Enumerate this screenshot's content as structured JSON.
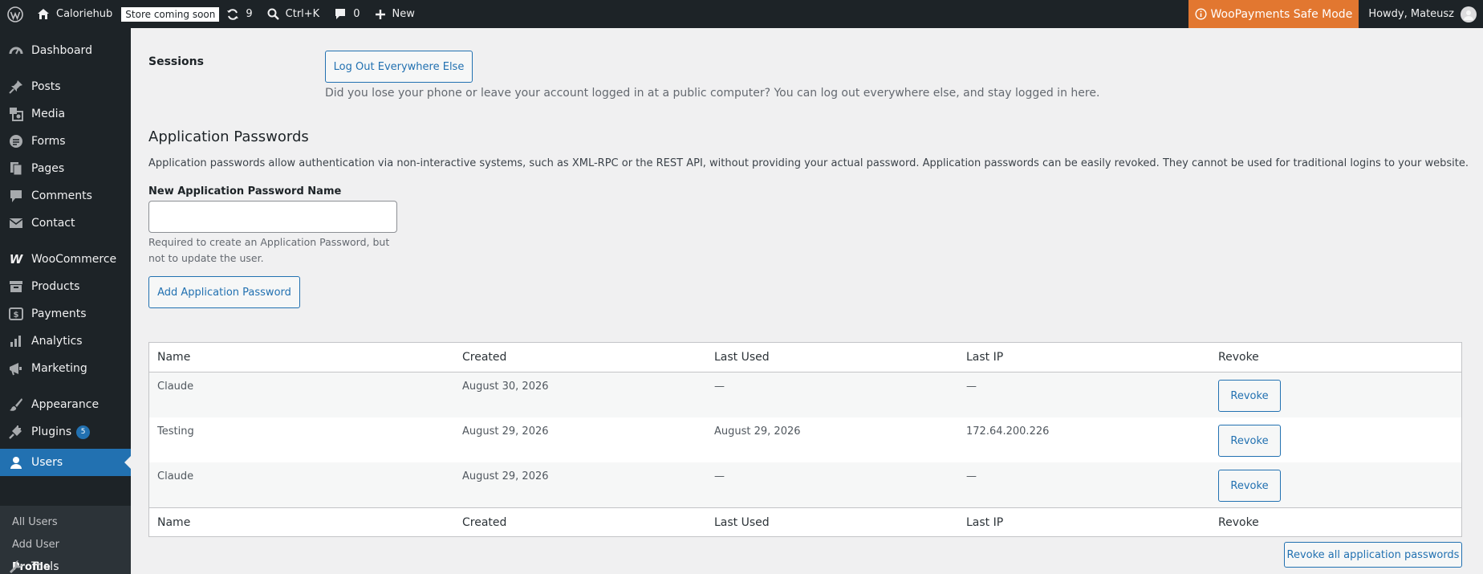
{
  "adminbar": {
    "site_name": "Caloriehub",
    "store_badge": "Store coming soon",
    "updates_count": "9",
    "search_shortcut": "Ctrl+K",
    "comments_count": "0",
    "new_label": "New",
    "woopayments_notice": "WooPayments Safe Mode",
    "howdy": "Howdy, Mateusz",
    "safe_mode_color": "#e27730"
  },
  "sidebar": {
    "items": [
      {
        "label": "Dashboard",
        "icon": "dashboard-icon"
      },
      {
        "label": "Posts",
        "icon": "pin-icon"
      },
      {
        "label": "Media",
        "icon": "media-icon"
      },
      {
        "label": "Forms",
        "icon": "forms-icon"
      },
      {
        "label": "Pages",
        "icon": "pages-icon"
      },
      {
        "label": "Comments",
        "icon": "comments-icon"
      },
      {
        "label": "Contact",
        "icon": "mail-icon"
      },
      {
        "label": "WooCommerce",
        "icon": "woocommerce-icon"
      },
      {
        "label": "Products",
        "icon": "archive-icon"
      },
      {
        "label": "Payments",
        "icon": "payments-icon"
      },
      {
        "label": "Analytics",
        "icon": "analytics-icon"
      },
      {
        "label": "Marketing",
        "icon": "megaphone-icon"
      },
      {
        "label": "Appearance",
        "icon": "brush-icon"
      },
      {
        "label": "Plugins",
        "icon": "plugin-icon",
        "badge": "5"
      },
      {
        "label": "Users",
        "icon": "users-icon"
      },
      {
        "label": "Tools",
        "icon": "wrench-icon"
      }
    ],
    "submenu": [
      "All Users",
      "Add User",
      "Profile"
    ],
    "accent_color": "#2271b1"
  },
  "sessions": {
    "label": "Sessions",
    "button": "Log Out Everywhere Else",
    "description": "Did you lose your phone or leave your account logged in at a public computer? You can log out everywhere else, and stay logged in here."
  },
  "app_passwords": {
    "heading": "Application Passwords",
    "intro": "Application passwords allow authentication via non-interactive systems, such as XML-RPC or the REST API, without providing your actual password. Application passwords can be easily revoked. They cannot be used for traditional logins to your website.",
    "field_label": "New Application Password Name",
    "field_value": "",
    "help_text": "Required to create an Application Password, but not to update the user.",
    "add_button": "Add Application Password",
    "columns": [
      "Name",
      "Created",
      "Last Used",
      "Last IP",
      "Revoke"
    ],
    "rows": [
      {
        "name": "Claude",
        "created": "August 30, 2026",
        "last_used": "—",
        "last_ip": "—",
        "revoke": "Revoke"
      },
      {
        "name": "Testing",
        "created": "August 29, 2026",
        "last_used": "August 29, 2026",
        "last_ip": "172.64.200.226",
        "revoke": "Revoke"
      },
      {
        "name": "Claude",
        "created": "August 29, 2026",
        "last_used": "—",
        "last_ip": "—",
        "revoke": "Revoke"
      }
    ],
    "revoke_all_button": "Revoke all application passwords"
  }
}
